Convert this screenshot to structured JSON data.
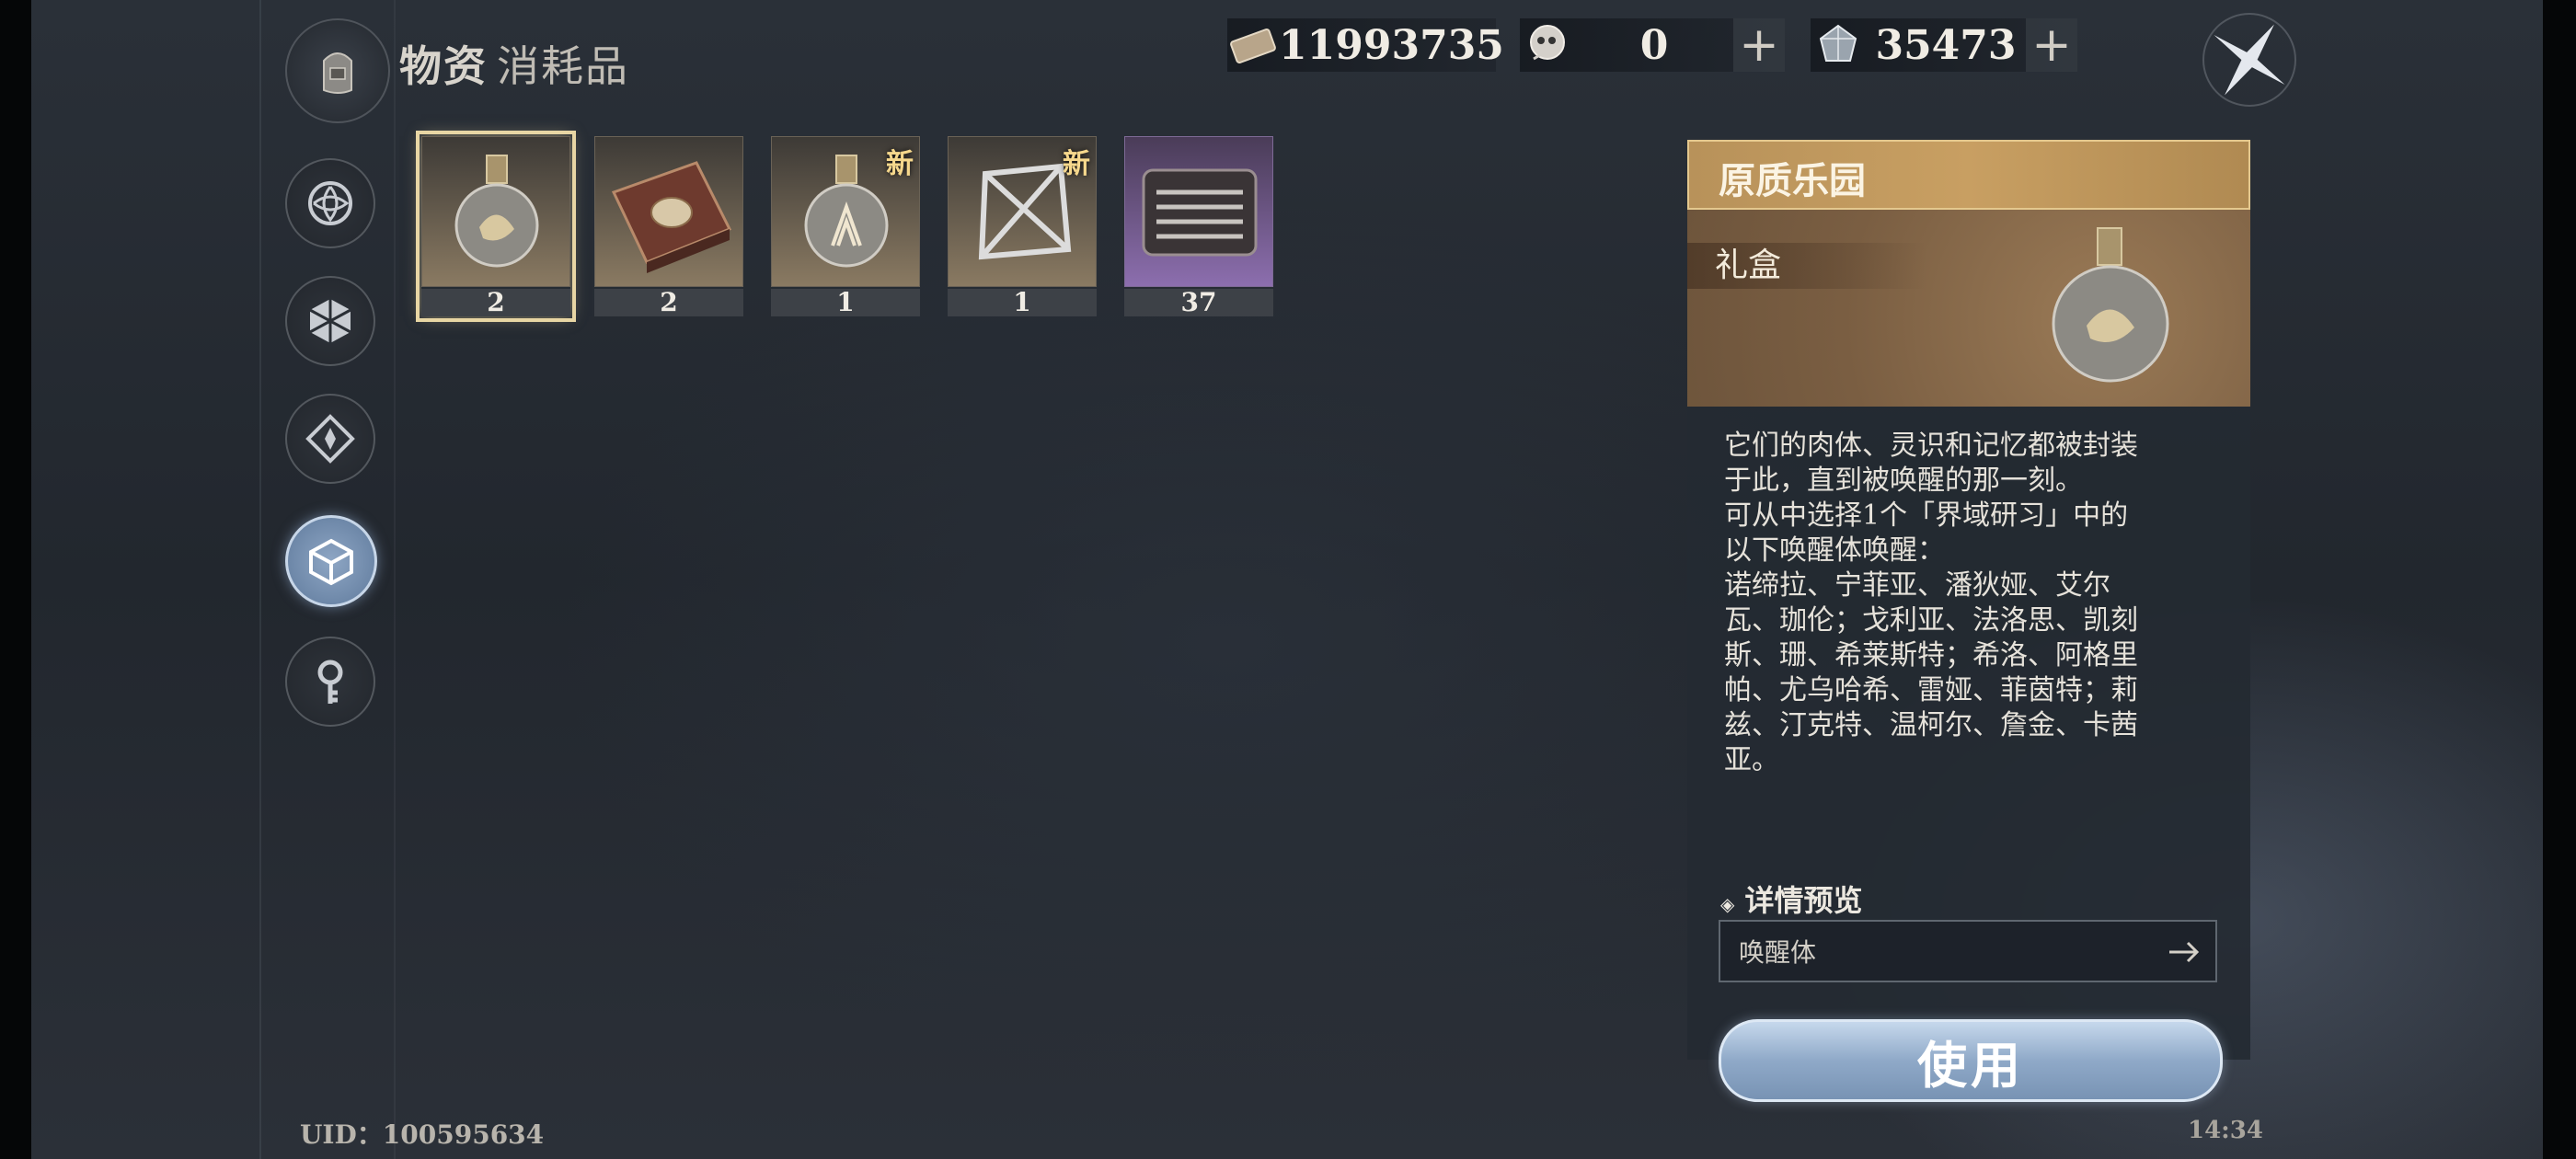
{
  "header": {
    "title": "物资",
    "subtitle": "消耗品"
  },
  "currencies": [
    {
      "icon": "ticket-icon",
      "value": "11993735",
      "has_add": false
    },
    {
      "icon": "skull-coin-icon",
      "value": "0",
      "has_add": true,
      "add_label": "+"
    },
    {
      "icon": "crystal-icon",
      "value": "35473",
      "has_add": true,
      "add_label": "+"
    }
  ],
  "nav": [
    {
      "icon": "swirl-icon",
      "active": false
    },
    {
      "icon": "gem-icon",
      "active": false
    },
    {
      "icon": "diamond-icon",
      "active": false
    },
    {
      "icon": "cube-icon",
      "active": true
    },
    {
      "icon": "key-icon",
      "active": false
    }
  ],
  "items": [
    {
      "art": "flask-icon",
      "count": "2",
      "selected": true,
      "new": ""
    },
    {
      "art": "book-icon",
      "count": "2",
      "selected": false,
      "new": ""
    },
    {
      "art": "flask-icon",
      "count": "1",
      "selected": false,
      "new": "新"
    },
    {
      "art": "crystal-frame-icon",
      "count": "1",
      "selected": false,
      "new": "新"
    },
    {
      "art": "tool-case-icon",
      "count": "37",
      "selected": false,
      "new": "",
      "rarity": "purple"
    }
  ],
  "detail": {
    "title": "原质乐园",
    "type": "礼盒",
    "description": "它们的肉体、灵识和记忆都被封装\n于此，直到被唤醒的那一刻。\n可从中选择1个「界域研习」中的\n以下唤醒体唤醒：\n诺缔拉、宁菲亚、潘狄娅、艾尔\n瓦、珈伦；戈利亚、法洛思、凯刻\n斯、珊、希莱斯特；希洛、阿格里\n帕、尤乌哈希、雷娅、菲茵特；莉\n兹、汀克特、温柯尔、詹金、卡茜\n亚。",
    "preview_label": "详情预览",
    "preview_value": "唤醒体",
    "use_button": "使用"
  },
  "footer": {
    "uid": "UID：100595634",
    "time": "14:34"
  }
}
